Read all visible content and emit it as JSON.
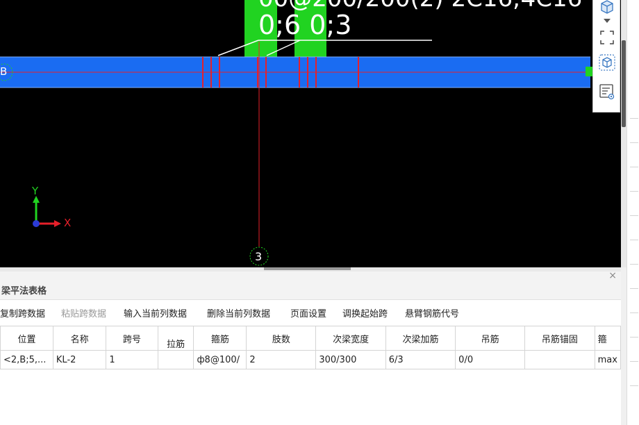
{
  "drawing": {
    "partial_label_top": "00@200/200(2) 2C16;4C16",
    "span_label": "0;6 0;3",
    "axis_b": "B",
    "axis_3": "3",
    "axis_y": "Y",
    "axis_x": "X"
  },
  "colors": {
    "beam": "#1a6cf2",
    "column": "#21d321",
    "rebar_red": "#e6202a",
    "background": "#000000"
  },
  "toolstrip": {
    "icons": [
      "cube-view-icon",
      "dropdown-icon",
      "fullscreen-icon",
      "3d-box-icon",
      "display-settings-icon"
    ]
  },
  "panel": {
    "title": "梁平法表格",
    "close": "×",
    "toolbar": {
      "copy_span": "复制跨数据",
      "paste_span": "粘贴跨数据",
      "input_column": "输入当前列数据",
      "delete_column": "删除当前列数据",
      "page_setup": "页面设置",
      "swap_start": "调换起始跨",
      "cantilever_code": "悬臂钢筋代号"
    },
    "table": {
      "headers": {
        "position": "位置",
        "name": "名称",
        "span_no": "跨号",
        "tie_bar": "拉筋",
        "stirrup": "箍筋",
        "legs": "肢数",
        "sec_beam_width": "次梁宽度",
        "sec_beam_rebar": "次梁加筋",
        "hanger": "吊筋",
        "hanger_anchor": "吊筋锚固",
        "stirrup2": "箍"
      },
      "row": {
        "position": "<2,B;5,...",
        "name": "KL-2",
        "span_no": "1",
        "tie_bar": "",
        "stirrup": "ф8@100/",
        "legs": "2",
        "sec_beam_width": "300/300",
        "sec_beam_rebar": "6/3",
        "hanger": "0/0",
        "hanger_anchor": "",
        "stirrup2": "max"
      }
    }
  }
}
